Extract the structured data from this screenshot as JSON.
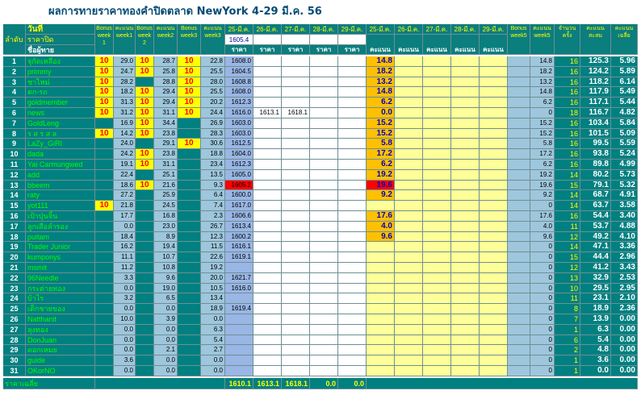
{
  "title": "ผลการทายราคาทองคำปิดตลาด NewYork 4-29 มี.ค. 56",
  "header": {
    "rank_label": "ลำดับ",
    "date_label": "วันที่",
    "close_price_label": "ราคาปิด",
    "name_label": "ชื่อผู้ทาย",
    "bonus1": "Bonus week 1",
    "score_week1": "คะแนน week1",
    "bonus2": "Bonus week 2",
    "score_week2": "คะแนน week2",
    "bonus3": "Bonus week3",
    "score_week3": "คะแนน week3",
    "price_dates": [
      "25-มี.ค.",
      "26-มี.ค.",
      "27-มี.ค.",
      "28-มี.ค.",
      "29-มี.ค."
    ],
    "price_label": "ราคา",
    "score_dates": [
      "25-มี.ค.",
      "26-มี.ค.",
      "27-มี.ค.",
      "28-มี.ค.",
      "29-มี.ค."
    ],
    "score_label": "คะแนน",
    "bonus5": "Bonus week5",
    "score_week5": "คะแนน week5",
    "count_label": "จำนวนครั้ง",
    "total_label": "คะแนนสะสม",
    "avg_label": "คะแนนเฉลี่ย",
    "close_prices": [
      "1605.4",
      "",
      "",
      "",
      ""
    ]
  },
  "rows": [
    {
      "no": "1",
      "name": "จุกัดเหลือง",
      "b1": "10",
      "w1": "29.0",
      "b2": "10",
      "w2": "28.7",
      "b3": "10",
      "w3": "22.8",
      "p": [
        "1608.0",
        "",
        "",
        "",
        ""
      ],
      "s": [
        "14.8",
        "",
        "",
        "",
        ""
      ],
      "b5": "",
      "w5": "14.8",
      "cnt": "16",
      "total": "125.3",
      "avg": "5.96"
    },
    {
      "no": "2",
      "name": "primmy",
      "b1": "10",
      "w1": "24.7",
      "b2": "10",
      "w2": "25.8",
      "b3": "10",
      "w3": "25.5",
      "p": [
        "1604.5",
        "",
        "",
        "",
        ""
      ],
      "s": [
        "18.2",
        "",
        "",
        "",
        ""
      ],
      "b5": "",
      "w5": "18.2",
      "cnt": "16",
      "total": "124.2",
      "avg": "5.89"
    },
    {
      "no": "3",
      "name": "ชาไหม่",
      "b1": "10",
      "w1": "28.2",
      "b2": "",
      "w2": "28.8",
      "b3": "10",
      "w3": "28.0",
      "p": [
        "1608.8",
        "",
        "",
        "",
        ""
      ],
      "s": [
        "13.2",
        "",
        "",
        "",
        ""
      ],
      "b5": "",
      "w5": "13.2",
      "cnt": "16",
      "total": "118.2",
      "avg": "6.14"
    },
    {
      "no": "4",
      "name": "ตก-รถ",
      "b1": "10",
      "w1": "18.2",
      "b2": "10",
      "w2": "29.4",
      "b3": "10",
      "w3": "25.5",
      "p": [
        "1608.0",
        "",
        "",
        "",
        ""
      ],
      "s": [
        "14.8",
        "",
        "",
        "",
        ""
      ],
      "b5": "",
      "w5": "14.8",
      "cnt": "16",
      "total": "117.9",
      "avg": "5.49"
    },
    {
      "no": "5",
      "name": "goldmember",
      "b1": "10",
      "w1": "31.3",
      "b2": "10",
      "w2": "29.4",
      "b3": "10",
      "w3": "20.2",
      "p": [
        "1612.3",
        "",
        "",
        "",
        ""
      ],
      "s": [
        "6.2",
        "",
        "",
        "",
        ""
      ],
      "b5": "",
      "w5": "6.2",
      "cnt": "16",
      "total": "117.1",
      "avg": "5.44"
    },
    {
      "no": "6",
      "name": "news",
      "b1": "10",
      "w1": "31.2",
      "b2": "10",
      "w2": "31.1",
      "b3": "10",
      "w3": "24.4",
      "p": [
        "1616.0",
        "1613.1",
        "1618.1",
        "",
        ""
      ],
      "s": [
        "0.0",
        "",
        "",
        "",
        ""
      ],
      "b5": "",
      "w5": "0",
      "cnt": "18",
      "total": "116.7",
      "avg": "4.82"
    },
    {
      "no": "7",
      "name": "GoldLeng",
      "b1": "",
      "w1": "16.9",
      "b2": "10",
      "w2": "34.4",
      "b3": "",
      "w3": "26.9",
      "p": [
        "1603.0",
        "",
        "",
        "",
        ""
      ],
      "s": [
        "15.2",
        "",
        "",
        "",
        ""
      ],
      "b5": "",
      "w5": "15.2",
      "cnt": "16",
      "total": "103.4",
      "avg": "5.84"
    },
    {
      "no": "8",
      "name": "ร ส ร ส ล",
      "b1": "10",
      "w1": "14.2",
      "b2": "10",
      "w2": "23.8",
      "b3": "",
      "w3": "28.3",
      "p": [
        "1603.0",
        "",
        "",
        "",
        ""
      ],
      "s": [
        "15.2",
        "",
        "",
        "",
        ""
      ],
      "b5": "",
      "w5": "15.2",
      "cnt": "16",
      "total": "101.5",
      "avg": "5.09"
    },
    {
      "no": "9",
      "name": "LaZy_GiRl",
      "b1": "",
      "w1": "24.0",
      "b2": "",
      "w2": "29.1",
      "b3": "10",
      "w3": "30.6",
      "p": [
        "1612.5",
        "",
        "",
        "",
        ""
      ],
      "s": [
        "5.8",
        "",
        "",
        "",
        ""
      ],
      "b5": "",
      "w5": "5.8",
      "cnt": "16",
      "total": "99.5",
      "avg": "5.59"
    },
    {
      "no": "10",
      "name": "dada",
      "b1": "",
      "w1": "24.2",
      "b2": "10",
      "w2": "23.8",
      "b3": "",
      "w3": "18.8",
      "p": [
        "1604.0",
        "",
        "",
        "",
        ""
      ],
      "s": [
        "17.2",
        "",
        "",
        "",
        ""
      ],
      "b5": "",
      "w5": "17.2",
      "cnt": "16",
      "total": "93.8",
      "avg": "5.24"
    },
    {
      "no": "11",
      "name": "Yai Carmungwed",
      "b1": "",
      "w1": "19.1",
      "b2": "10",
      "w2": "31.1",
      "b3": "",
      "w3": "23.4",
      "p": [
        "1612.3",
        "",
        "",
        "",
        ""
      ],
      "s": [
        "6.2",
        "",
        "",
        "",
        ""
      ],
      "b5": "",
      "w5": "6.2",
      "cnt": "16",
      "total": "89.8",
      "avg": "4.99"
    },
    {
      "no": "12",
      "name": "add",
      "b1": "",
      "w1": "22.4",
      "b2": "",
      "w2": "25.1",
      "b3": "",
      "w3": "13.5",
      "p": [
        "1605.0",
        "",
        "",
        "",
        ""
      ],
      "s": [
        "19.2",
        "",
        "",
        "",
        ""
      ],
      "b5": "",
      "w5": "19.2",
      "cnt": "14",
      "total": "80.2",
      "avg": "5.73"
    },
    {
      "no": "13",
      "name": "bbeem",
      "b1": "",
      "w1": "18.6",
      "b2": "10",
      "w2": "21.6",
      "b3": "",
      "w3": "9.3",
      "p": [
        "1605.2",
        "",
        "",
        "",
        ""
      ],
      "s": [
        "19.6",
        "",
        "",
        "",
        ""
      ],
      "b5": "",
      "w5": "19.6",
      "cnt": "15",
      "total": "79.1",
      "avg": "5.32"
    },
    {
      "no": "14",
      "name": "raty",
      "b1": "",
      "w1": "27.2",
      "b2": "",
      "w2": "25.9",
      "b3": "",
      "w3": "6.4",
      "p": [
        "1600.0",
        "",
        "",
        "",
        ""
      ],
      "s": [
        "9.2",
        "",
        "",
        "",
        ""
      ],
      "b5": "",
      "w5": "9.2",
      "cnt": "14",
      "total": "68.7",
      "avg": "4.91"
    },
    {
      "no": "15",
      "name": "yot111",
      "b1": "10",
      "w1": "21.8",
      "b2": "",
      "w2": "24.5",
      "b3": "",
      "w3": "7.4",
      "p": [
        "1617.0",
        "",
        "",
        "",
        ""
      ],
      "s": [
        "",
        "",
        "",
        "",
        ""
      ],
      "b5": "",
      "w5": "0",
      "cnt": "14",
      "total": "63.7",
      "avg": "3.58"
    },
    {
      "no": "16",
      "name": "เป้าปุ่นจิ้น",
      "b1": "",
      "w1": "17.7",
      "b2": "",
      "w2": "16.8",
      "b3": "",
      "w3": "2.3",
      "p": [
        "1606.6",
        "",
        "",
        "",
        ""
      ],
      "s": [
        "17.6",
        "",
        "",
        "",
        ""
      ],
      "b5": "",
      "w5": "17.6",
      "cnt": "16",
      "total": "54.4",
      "avg": "3.40"
    },
    {
      "no": "17",
      "name": "ลูกเสือลำรอง",
      "b1": "",
      "w1": "0.0",
      "b2": "",
      "w2": "23.0",
      "b3": "",
      "w3": "26.7",
      "p": [
        "1613.4",
        "",
        "",
        "",
        ""
      ],
      "s": [
        "4.0",
        "",
        "",
        "",
        ""
      ],
      "b5": "",
      "w5": "4.0",
      "cnt": "11",
      "total": "53.7",
      "avg": "4.88"
    },
    {
      "no": "18",
      "name": "puitam",
      "b1": "",
      "w1": "18.4",
      "b2": "",
      "w2": "8.9",
      "b3": "",
      "w3": "12.3",
      "p": [
        "1600.2",
        "",
        "",
        "",
        ""
      ],
      "s": [
        "9.6",
        "",
        "",
        "",
        ""
      ],
      "b5": "",
      "w5": "9.6",
      "cnt": "12",
      "total": "49.2",
      "avg": "4.10"
    },
    {
      "no": "19",
      "name": "Trader Junior",
      "b1": "",
      "w1": "16.2",
      "b2": "",
      "w2": "19.4",
      "b3": "",
      "w3": "11.5",
      "p": [
        "1616.1",
        "",
        "",
        "",
        ""
      ],
      "s": [
        "",
        "",
        "",
        "",
        ""
      ],
      "b5": "",
      "w5": "0",
      "cnt": "14",
      "total": "47.1",
      "avg": "3.36"
    },
    {
      "no": "20",
      "name": "kumponys",
      "b1": "",
      "w1": "11.1",
      "b2": "",
      "w2": "10.7",
      "b3": "",
      "w3": "22.6",
      "p": [
        "1619.1",
        "",
        "",
        "",
        ""
      ],
      "s": [
        "",
        "",
        "",
        "",
        ""
      ],
      "b5": "",
      "w5": "0",
      "cnt": "15",
      "total": "44.4",
      "avg": "2.96"
    },
    {
      "no": "21",
      "name": "msmit",
      "b1": "",
      "w1": "11.2",
      "b2": "",
      "w2": "10.8",
      "b3": "",
      "w3": "19.2",
      "p": [
        "",
        "",
        "",
        "",
        ""
      ],
      "s": [
        "",
        "",
        "",
        "",
        ""
      ],
      "b5": "",
      "w5": "0",
      "cnt": "12",
      "total": "41.2",
      "avg": "3.43"
    },
    {
      "no": "22",
      "name": "96Needle",
      "b1": "",
      "w1": "3.3",
      "b2": "",
      "w2": "9.6",
      "b3": "",
      "w3": "20.0",
      "p": [
        "1621.7",
        "",
        "",
        "",
        ""
      ],
      "s": [
        "",
        "",
        "",
        "",
        ""
      ],
      "b5": "",
      "w5": "0",
      "cnt": "13",
      "total": "32.9",
      "avg": "2.53"
    },
    {
      "no": "23",
      "name": "กระต่ายทอง",
      "b1": "",
      "w1": "0.0",
      "b2": "",
      "w2": "19.0",
      "b3": "",
      "w3": "10.5",
      "p": [
        "1616.0",
        "",
        "",
        "",
        ""
      ],
      "s": [
        "",
        "",
        "",
        "",
        ""
      ],
      "b5": "",
      "w5": "0",
      "cnt": "10",
      "total": "29.5",
      "avg": "2.95"
    },
    {
      "no": "24",
      "name": "บ้าไร",
      "b1": "",
      "w1": "3.2",
      "b2": "",
      "w2": "6.5",
      "b3": "",
      "w3": "13.4",
      "p": [
        "",
        "",
        "",
        "",
        ""
      ],
      "s": [
        "",
        "",
        "",
        "",
        ""
      ],
      "b5": "",
      "w5": "0",
      "cnt": "11",
      "total": "23.1",
      "avg": "2.10"
    },
    {
      "no": "25",
      "name": "เด็กชายของ",
      "b1": "",
      "w1": "0.0",
      "b2": "",
      "w2": "0.0",
      "b3": "",
      "w3": "18.9",
      "p": [
        "1619.4",
        "",
        "",
        "",
        ""
      ],
      "s": [
        "",
        "",
        "",
        "",
        ""
      ],
      "b5": "",
      "w5": "0",
      "cnt": "8",
      "total": "18.9",
      "avg": "2.36"
    },
    {
      "no": "26",
      "name": "Natthanit",
      "b1": "",
      "w1": "10.0",
      "b2": "",
      "w2": "3.9",
      "b3": "",
      "w3": "0.0",
      "p": [
        "",
        "",
        "",
        "",
        ""
      ],
      "s": [
        "",
        "",
        "",
        "",
        ""
      ],
      "b5": "",
      "w5": "0",
      "cnt": "7",
      "total": "13.9",
      "avg": "0.00"
    },
    {
      "no": "27",
      "name": "ลุงทอง",
      "b1": "",
      "w1": "0.0",
      "b2": "",
      "w2": "0.0",
      "b3": "",
      "w3": "6.3",
      "p": [
        "",
        "",
        "",
        "",
        ""
      ],
      "s": [
        "",
        "",
        "",
        "",
        ""
      ],
      "b5": "",
      "w5": "0",
      "cnt": "1",
      "total": "6.3",
      "avg": "0.00"
    },
    {
      "no": "28",
      "name": "DonJuan",
      "b1": "",
      "w1": "0.0",
      "b2": "",
      "w2": "0.0",
      "b3": "",
      "w3": "5.4",
      "p": [
        "",
        "",
        "",
        "",
        ""
      ],
      "s": [
        "",
        "",
        "",
        "",
        ""
      ],
      "b5": "",
      "w5": "0",
      "cnt": "6",
      "total": "5.4",
      "avg": "0.00"
    },
    {
      "no": "29",
      "name": "ดอกเหมย",
      "b1": "",
      "w1": "0.0",
      "b2": "",
      "w2": "2.1",
      "b3": "",
      "w3": "2.7",
      "p": [
        "",
        "",
        "",
        "",
        ""
      ],
      "s": [
        "",
        "",
        "",
        "",
        ""
      ],
      "b5": "",
      "w5": "0",
      "cnt": "2",
      "total": "4.8",
      "avg": "0.00"
    },
    {
      "no": "30",
      "name": "guide",
      "b1": "",
      "w1": "3.6",
      "b2": "",
      "w2": "0.0",
      "b3": "",
      "w3": "0.0",
      "p": [
        "",
        "",
        "",
        "",
        ""
      ],
      "s": [
        "",
        "",
        "",
        "",
        ""
      ],
      "b5": "",
      "w5": "0",
      "cnt": "1",
      "total": "3.6",
      "avg": "0.00"
    },
    {
      "no": "31",
      "name": "OKorNO",
      "b1": "",
      "w1": "0.0",
      "b2": "",
      "w2": "0.0",
      "b3": "",
      "w3": "0.0",
      "p": [
        "",
        "",
        "",
        "",
        ""
      ],
      "s": [
        "",
        "",
        "",
        "",
        ""
      ],
      "b5": "",
      "w5": "0",
      "cnt": "1",
      "total": "0.0",
      "avg": "0.00"
    }
  ],
  "footer": {
    "label": "ราคาเฉลี่ย",
    "avg_prices": [
      "1610.1",
      "1613.1",
      "1618.1",
      "0.0",
      "0.0"
    ]
  },
  "highlight": {
    "bad_score_row": "13",
    "colors": {
      "teal": "#008080",
      "header_teal": "#0b7e7e",
      "yellow_label": "#ffff00",
      "bonus_yellow": "#ffff00",
      "bonus_red": "#ff0000",
      "score_blue": "#9ec6dc",
      "price_blue": "#99b6e5",
      "score_orange": "#ffc000",
      "score_zone": "#ffff99",
      "highlight_red": "#ff0000",
      "bright_green": "#00ff00"
    }
  }
}
